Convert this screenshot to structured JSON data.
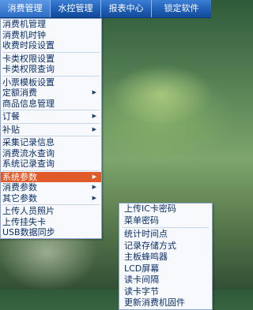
{
  "tabs": [
    {
      "label": "消费管理"
    },
    {
      "label": "水控管理"
    },
    {
      "label": "报表中心"
    },
    {
      "label": "锁定软件"
    }
  ],
  "menu": {
    "items": [
      {
        "label": "消费机管理"
      },
      {
        "label": "消费机时钟"
      },
      {
        "label": "收费时段设置"
      },
      {
        "label": "卡类权限设置"
      },
      {
        "label": "卡类权限查询"
      },
      {
        "label": "小票模板设置"
      },
      {
        "label": "定额消费"
      },
      {
        "label": "商品信息管理"
      },
      {
        "label": "订餐"
      },
      {
        "label": "补贴"
      },
      {
        "label": "采集记录信息"
      },
      {
        "label": "消费流水查询"
      },
      {
        "label": "系统记录查询"
      },
      {
        "label": "系统参数"
      },
      {
        "label": "消费参数"
      },
      {
        "label": "其它参数"
      },
      {
        "label": "上传人员照片"
      },
      {
        "label": "上传挂失卡"
      },
      {
        "label": "USB数据同步"
      }
    ]
  },
  "submenu": {
    "items": [
      {
        "label": "上传IC卡密码"
      },
      {
        "label": "菜单密码"
      },
      {
        "label": "统计时间点"
      },
      {
        "label": "记录存储方式"
      },
      {
        "label": "主板蜂鸣器"
      },
      {
        "label": "LCD屏幕"
      },
      {
        "label": "读卡间隔"
      },
      {
        "label": "读卡字节"
      },
      {
        "label": "更新消费机固件"
      }
    ]
  },
  "arrow_glyph": "▶",
  "colors": {
    "topbar": "#1f5fb6",
    "highlight": "#e05a2a",
    "menu_bg": "#f7f9fc",
    "menu_text": "#0b2f6a"
  }
}
